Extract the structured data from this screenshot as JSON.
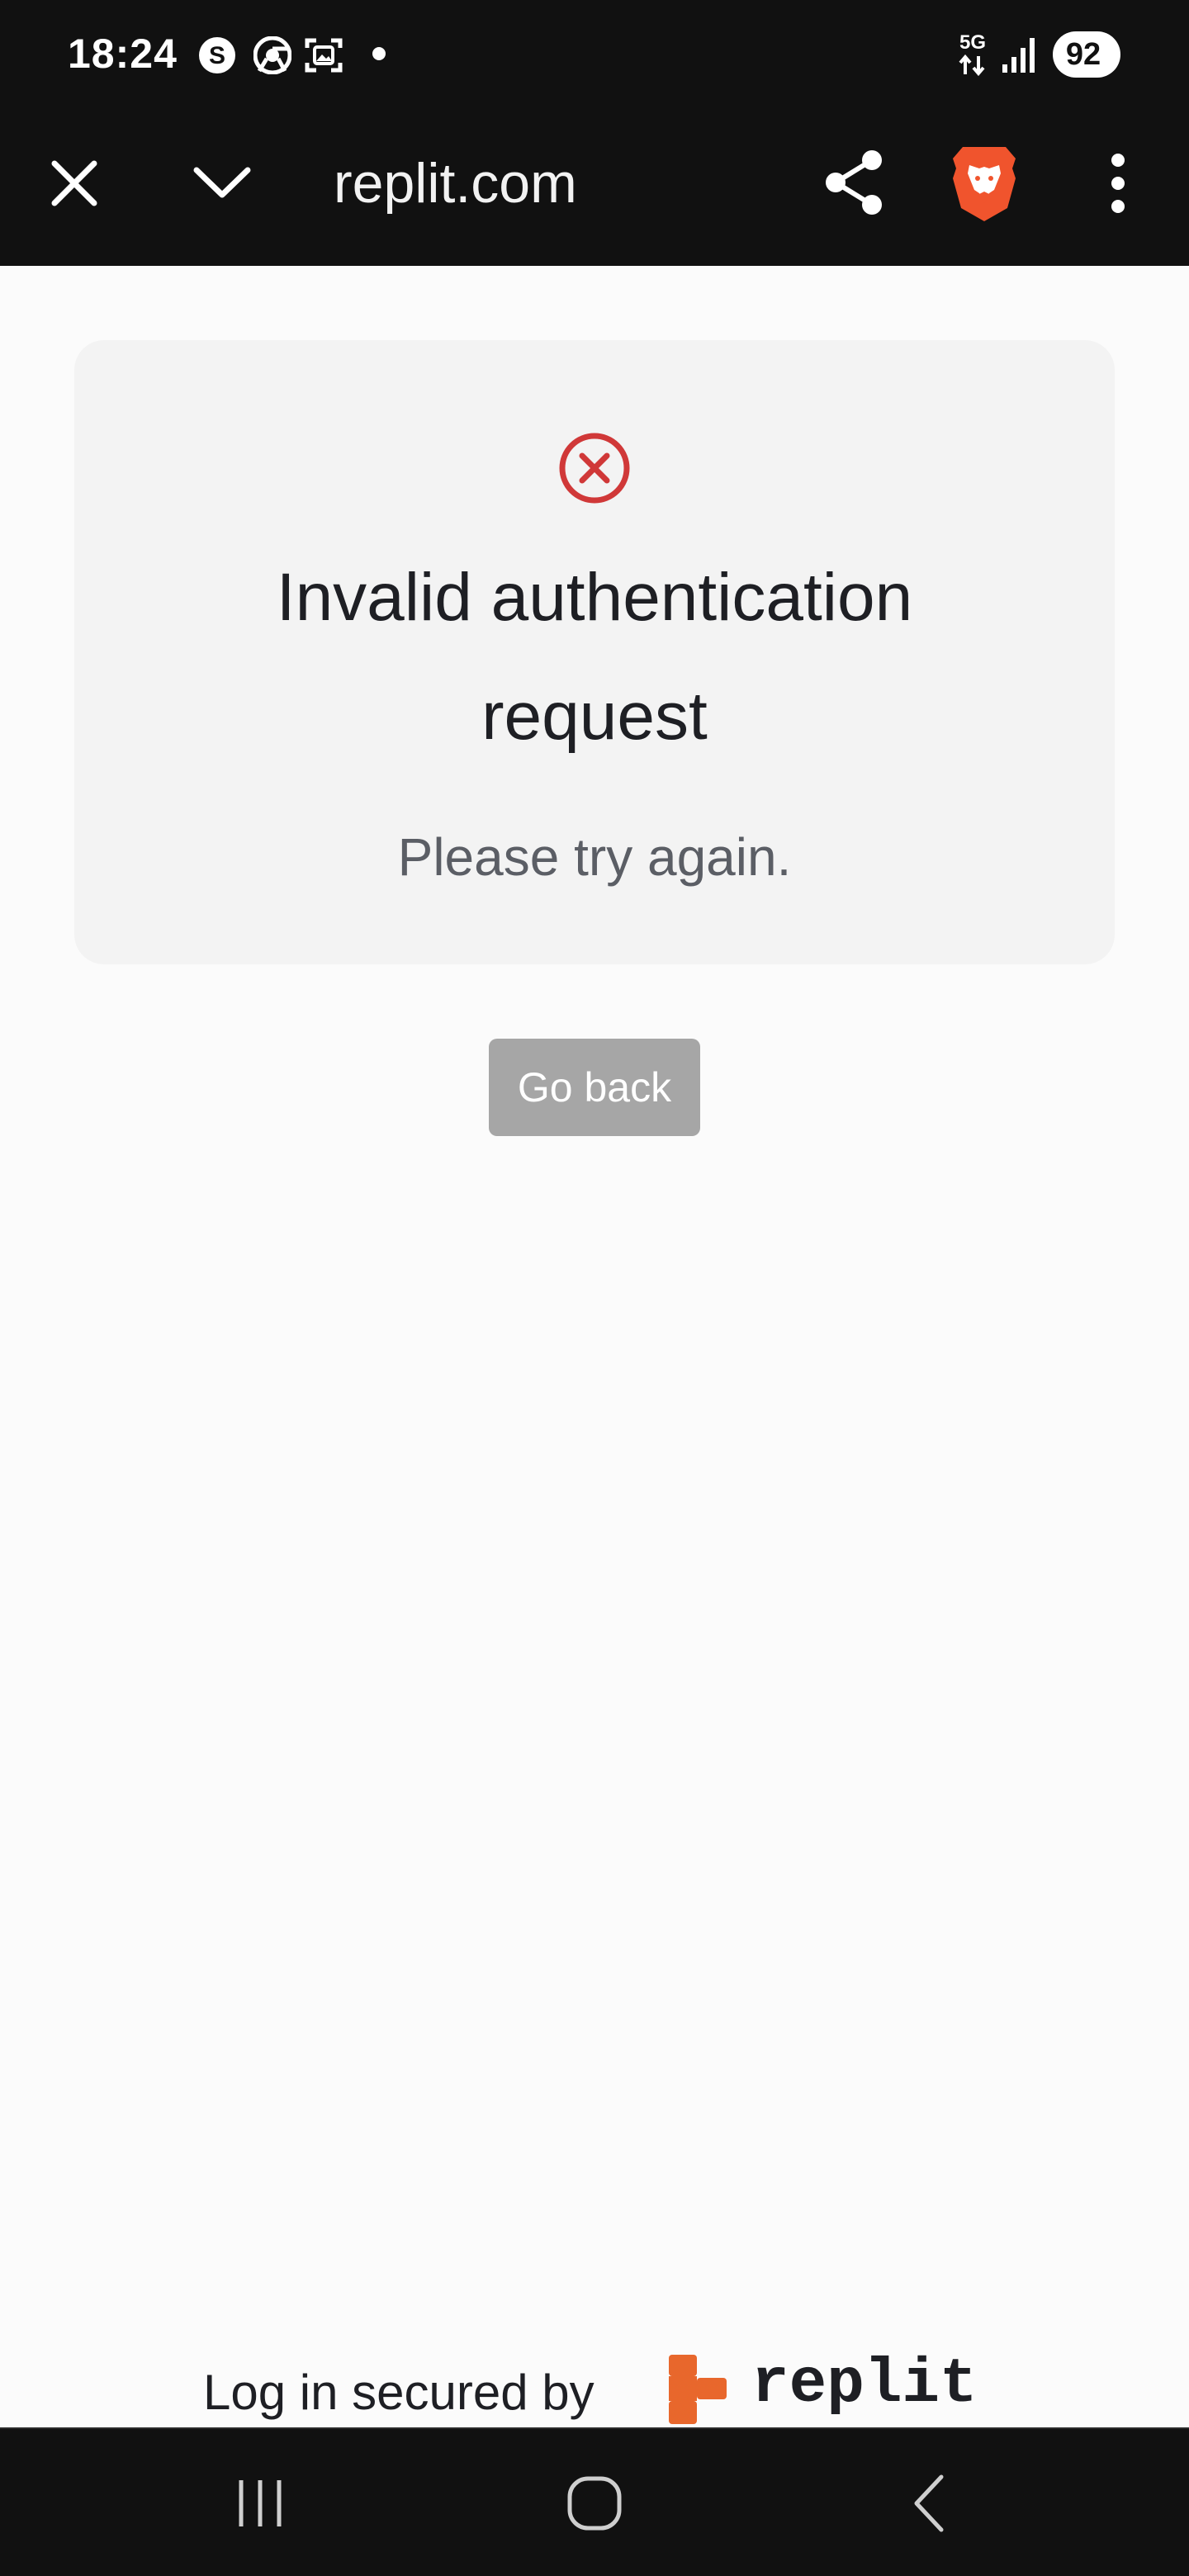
{
  "status_bar": {
    "time": "18:24",
    "network": "5G",
    "battery": "92",
    "icons": [
      "s-icon",
      "chrome-icon",
      "screenshot-icon",
      "notification-dot",
      "network-5g-icon",
      "signal-icon",
      "battery-icon"
    ]
  },
  "toolbar": {
    "url": "replit.com",
    "icons": [
      "close-icon",
      "chevron-down-icon",
      "share-icon",
      "brave-lion-icon",
      "more-vert-icon"
    ]
  },
  "error": {
    "icon": "error-circle-x-icon",
    "title_line1": "Invalid authentication",
    "title_line2": "request",
    "subtitle": "Please try again."
  },
  "go_back_button": {
    "label": "Go back"
  },
  "footer": {
    "text": "Log in secured by",
    "brand": "replit",
    "brand_color": "#E8672C"
  },
  "nav_bar": {
    "icons": [
      "recent-apps-icon",
      "home-icon",
      "back-icon"
    ]
  },
  "colors": {
    "toolbar_bg": "#111111",
    "page_bg": "#FBFBFB",
    "card_bg": "#F3F3F3",
    "error_red": "#D03838",
    "button_bg": "#A6A6A6",
    "text_dark": "#1E1F24",
    "text_muted": "#5B5E65"
  }
}
